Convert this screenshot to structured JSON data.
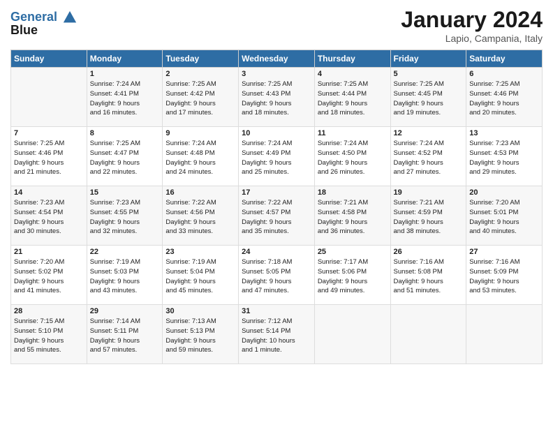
{
  "header": {
    "logo_line1": "General",
    "logo_line2": "Blue",
    "month_title": "January 2024",
    "location": "Lapio, Campania, Italy"
  },
  "days_of_week": [
    "Sunday",
    "Monday",
    "Tuesday",
    "Wednesday",
    "Thursday",
    "Friday",
    "Saturday"
  ],
  "weeks": [
    [
      {
        "day": "",
        "info": ""
      },
      {
        "day": "1",
        "info": "Sunrise: 7:24 AM\nSunset: 4:41 PM\nDaylight: 9 hours\nand 16 minutes."
      },
      {
        "day": "2",
        "info": "Sunrise: 7:25 AM\nSunset: 4:42 PM\nDaylight: 9 hours\nand 17 minutes."
      },
      {
        "day": "3",
        "info": "Sunrise: 7:25 AM\nSunset: 4:43 PM\nDaylight: 9 hours\nand 18 minutes."
      },
      {
        "day": "4",
        "info": "Sunrise: 7:25 AM\nSunset: 4:44 PM\nDaylight: 9 hours\nand 18 minutes."
      },
      {
        "day": "5",
        "info": "Sunrise: 7:25 AM\nSunset: 4:45 PM\nDaylight: 9 hours\nand 19 minutes."
      },
      {
        "day": "6",
        "info": "Sunrise: 7:25 AM\nSunset: 4:46 PM\nDaylight: 9 hours\nand 20 minutes."
      }
    ],
    [
      {
        "day": "7",
        "info": "Sunrise: 7:25 AM\nSunset: 4:46 PM\nDaylight: 9 hours\nand 21 minutes."
      },
      {
        "day": "8",
        "info": "Sunrise: 7:25 AM\nSunset: 4:47 PM\nDaylight: 9 hours\nand 22 minutes."
      },
      {
        "day": "9",
        "info": "Sunrise: 7:24 AM\nSunset: 4:48 PM\nDaylight: 9 hours\nand 24 minutes."
      },
      {
        "day": "10",
        "info": "Sunrise: 7:24 AM\nSunset: 4:49 PM\nDaylight: 9 hours\nand 25 minutes."
      },
      {
        "day": "11",
        "info": "Sunrise: 7:24 AM\nSunset: 4:50 PM\nDaylight: 9 hours\nand 26 minutes."
      },
      {
        "day": "12",
        "info": "Sunrise: 7:24 AM\nSunset: 4:52 PM\nDaylight: 9 hours\nand 27 minutes."
      },
      {
        "day": "13",
        "info": "Sunrise: 7:23 AM\nSunset: 4:53 PM\nDaylight: 9 hours\nand 29 minutes."
      }
    ],
    [
      {
        "day": "14",
        "info": "Sunrise: 7:23 AM\nSunset: 4:54 PM\nDaylight: 9 hours\nand 30 minutes."
      },
      {
        "day": "15",
        "info": "Sunrise: 7:23 AM\nSunset: 4:55 PM\nDaylight: 9 hours\nand 32 minutes."
      },
      {
        "day": "16",
        "info": "Sunrise: 7:22 AM\nSunset: 4:56 PM\nDaylight: 9 hours\nand 33 minutes."
      },
      {
        "day": "17",
        "info": "Sunrise: 7:22 AM\nSunset: 4:57 PM\nDaylight: 9 hours\nand 35 minutes."
      },
      {
        "day": "18",
        "info": "Sunrise: 7:21 AM\nSunset: 4:58 PM\nDaylight: 9 hours\nand 36 minutes."
      },
      {
        "day": "19",
        "info": "Sunrise: 7:21 AM\nSunset: 4:59 PM\nDaylight: 9 hours\nand 38 minutes."
      },
      {
        "day": "20",
        "info": "Sunrise: 7:20 AM\nSunset: 5:01 PM\nDaylight: 9 hours\nand 40 minutes."
      }
    ],
    [
      {
        "day": "21",
        "info": "Sunrise: 7:20 AM\nSunset: 5:02 PM\nDaylight: 9 hours\nand 41 minutes."
      },
      {
        "day": "22",
        "info": "Sunrise: 7:19 AM\nSunset: 5:03 PM\nDaylight: 9 hours\nand 43 minutes."
      },
      {
        "day": "23",
        "info": "Sunrise: 7:19 AM\nSunset: 5:04 PM\nDaylight: 9 hours\nand 45 minutes."
      },
      {
        "day": "24",
        "info": "Sunrise: 7:18 AM\nSunset: 5:05 PM\nDaylight: 9 hours\nand 47 minutes."
      },
      {
        "day": "25",
        "info": "Sunrise: 7:17 AM\nSunset: 5:06 PM\nDaylight: 9 hours\nand 49 minutes."
      },
      {
        "day": "26",
        "info": "Sunrise: 7:16 AM\nSunset: 5:08 PM\nDaylight: 9 hours\nand 51 minutes."
      },
      {
        "day": "27",
        "info": "Sunrise: 7:16 AM\nSunset: 5:09 PM\nDaylight: 9 hours\nand 53 minutes."
      }
    ],
    [
      {
        "day": "28",
        "info": "Sunrise: 7:15 AM\nSunset: 5:10 PM\nDaylight: 9 hours\nand 55 minutes."
      },
      {
        "day": "29",
        "info": "Sunrise: 7:14 AM\nSunset: 5:11 PM\nDaylight: 9 hours\nand 57 minutes."
      },
      {
        "day": "30",
        "info": "Sunrise: 7:13 AM\nSunset: 5:13 PM\nDaylight: 9 hours\nand 59 minutes."
      },
      {
        "day": "31",
        "info": "Sunrise: 7:12 AM\nSunset: 5:14 PM\nDaylight: 10 hours\nand 1 minute."
      },
      {
        "day": "",
        "info": ""
      },
      {
        "day": "",
        "info": ""
      },
      {
        "day": "",
        "info": ""
      }
    ]
  ]
}
